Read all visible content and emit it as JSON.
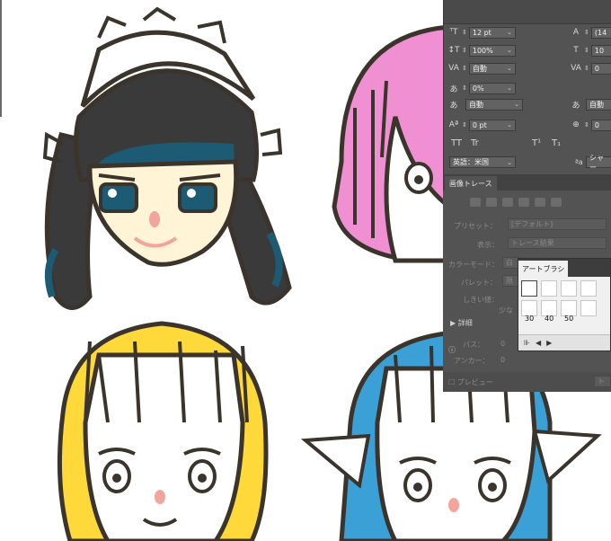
{
  "character_panel": {
    "font_size": "12 pt",
    "leading": "(14",
    "vertical_scale": "100%",
    "horizontal_scale_value": "10",
    "kerning": "自動",
    "tracking": "0",
    "tsume": "0%",
    "aki_left": "自動",
    "aki_right": "自動",
    "baseline_shift": "0 pt",
    "rotation": "0",
    "language": "英語：米国",
    "antialias": "シャー",
    "style_buttons": [
      "TT",
      "Tr",
      "T¹",
      "T₁"
    ]
  },
  "image_trace_panel": {
    "tab_label": "画像トレース",
    "preset_label": "プリセット：",
    "preset_value": "[デフォルト]",
    "view_label": "表示：",
    "view_value": "トレース結果",
    "mode_label": "カラーモード：",
    "mode_value": "白",
    "palette_label": "パレット：",
    "palette_value": "限",
    "threshold_label": "しきい値：",
    "threshold_hint": "少な",
    "advanced_label": "詳細",
    "paths_label": "パス：",
    "paths_value": "0",
    "anchors_label": "アンカー：",
    "anchors_value": "0",
    "preview_label": "プレビュー",
    "trace_button": "ト"
  },
  "art_brush_panel": {
    "tab_label": "アートブラシ",
    "brush_sizes": [
      "30",
      "40",
      "50"
    ]
  },
  "artwork": {
    "colors": {
      "outline": "#3b342c",
      "maid_hair": "#3a3a3a",
      "maid_hair_accent": "#1d5a73",
      "skin": "#fff4d6",
      "pink_hair": "#f08fd1",
      "yellow_hair": "#ffd83a",
      "blue_hair": "#3aa0d6",
      "blush": "#f4a59b"
    }
  }
}
